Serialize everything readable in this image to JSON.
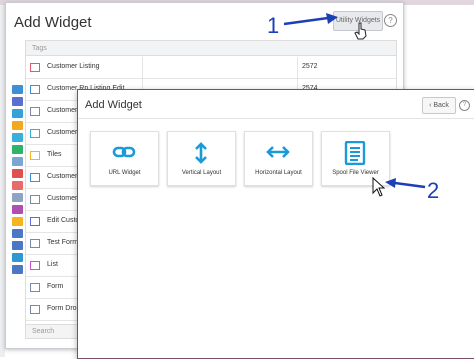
{
  "back_dialog": {
    "title": "Add Widget",
    "utility_button": "Utility Widgets",
    "help": "?",
    "tags_header": "Tags",
    "rows": [
      {
        "name": "Customer Listing",
        "count": "2572"
      },
      {
        "name": "Customer Rp Listing Edit",
        "count": "2574"
      },
      {
        "name": "Customer F",
        "count": ""
      },
      {
        "name": "Customer F",
        "count": ""
      },
      {
        "name": "Tiles",
        "count": ""
      },
      {
        "name": "Customer L",
        "count": ""
      },
      {
        "name": "Customer C",
        "count": ""
      },
      {
        "name": "Edit Custom",
        "count": ""
      },
      {
        "name": "Test Form",
        "count": ""
      },
      {
        "name": "List",
        "count": ""
      },
      {
        "name": "Form",
        "count": ""
      },
      {
        "name": "Form Drop",
        "count": ""
      }
    ],
    "search_placeholder": "Search"
  },
  "front_dialog": {
    "title": "Add Widget",
    "back_label": "Back",
    "help": "?",
    "tiles": [
      {
        "label": "URL Widget",
        "icon": "link-icon"
      },
      {
        "label": "Vertical Layout",
        "icon": "vertical-arrows-icon"
      },
      {
        "label": "Horizontal Layout",
        "icon": "horizontal-arrows-icon"
      },
      {
        "label": "Spool File Viewer",
        "icon": "document-lines-icon"
      }
    ]
  },
  "annotations": {
    "one": "1",
    "two": "2"
  },
  "colors": {
    "accent_blue": "#1a9bd7",
    "annotation_blue": "#1d3fb5",
    "front_border": "#7a4f6a"
  }
}
